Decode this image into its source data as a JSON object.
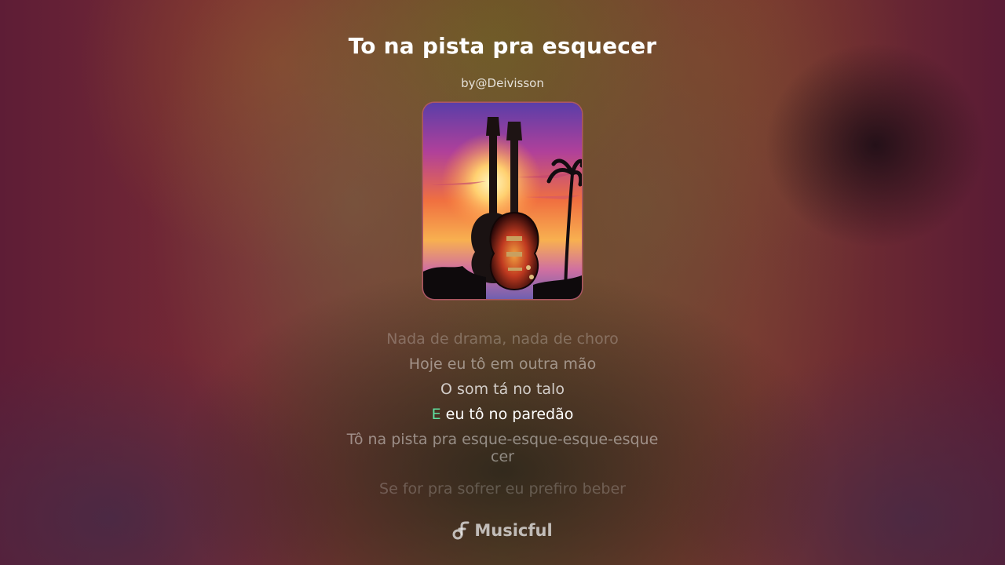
{
  "song": {
    "title": "To na pista pra esquecer",
    "author": "by@Deivisson"
  },
  "cover": {
    "description_icon": "guitar-sunset-artwork"
  },
  "lyrics": {
    "lines": [
      "Nada de drama, nada de choro",
      "Hoje eu tô em outra mão",
      "O som tá no talo",
      "eu tô no paredão",
      "Tô na pista pra esque-esque-esque-esque cer",
      "Se for pra sofrer eu prefiro beber"
    ],
    "current_sung_part": "E",
    "current_unsung_part": " eu tô no paredão"
  },
  "brand": {
    "name": "Musicful",
    "icon": "music-note-icon"
  },
  "colors": {
    "highlight": "#5fe0a0"
  }
}
